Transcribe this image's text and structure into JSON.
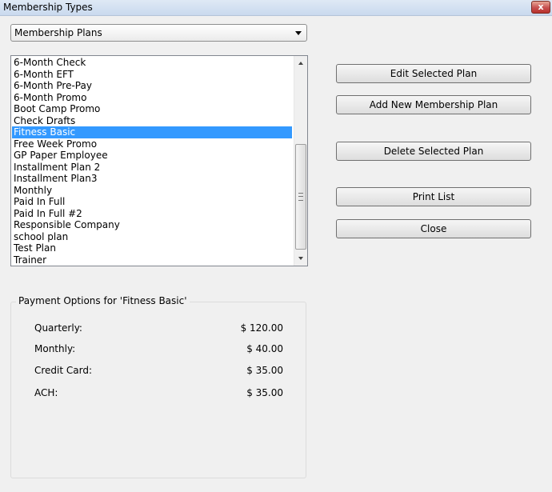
{
  "window": {
    "title": "Membership Types",
    "close_glyph": "x"
  },
  "filter_combo": {
    "selected": "Membership Plans"
  },
  "plans": [
    {
      "name": "6-Month Check",
      "selected": false
    },
    {
      "name": "6-Month EFT",
      "selected": false
    },
    {
      "name": "6-Month Pre-Pay",
      "selected": false
    },
    {
      "name": "6-Month Promo",
      "selected": false
    },
    {
      "name": "Boot Camp Promo",
      "selected": false
    },
    {
      "name": "Check Drafts",
      "selected": false
    },
    {
      "name": "Fitness Basic",
      "selected": true
    },
    {
      "name": "Free Week Promo",
      "selected": false
    },
    {
      "name": "GP Paper Employee",
      "selected": false
    },
    {
      "name": "Installment Plan 2",
      "selected": false
    },
    {
      "name": "Installment Plan3",
      "selected": false
    },
    {
      "name": "Monthly",
      "selected": false
    },
    {
      "name": "Paid In Full",
      "selected": false
    },
    {
      "name": "Paid In Full #2",
      "selected": false
    },
    {
      "name": "Responsible Company",
      "selected": false
    },
    {
      "name": "school plan",
      "selected": false
    },
    {
      "name": "Test Plan",
      "selected": false
    },
    {
      "name": "Trainer",
      "selected": false
    }
  ],
  "buttons": {
    "edit": "Edit Selected Plan",
    "add": "Add New Membership Plan",
    "delete": "Delete Selected Plan",
    "print": "Print List",
    "close": "Close"
  },
  "payment_options": {
    "legend": "Payment Options for 'Fitness Basic'",
    "rows": [
      {
        "label": "Quarterly:",
        "value": "$ 120.00"
      },
      {
        "label": "Monthly:",
        "value": "$ 40.00"
      },
      {
        "label": "Credit Card:",
        "value": "$ 35.00"
      },
      {
        "label": "ACH:",
        "value": "$ 35.00"
      }
    ]
  },
  "colors": {
    "selection": "#3399ff",
    "window_bg": "#f0f0f0"
  }
}
